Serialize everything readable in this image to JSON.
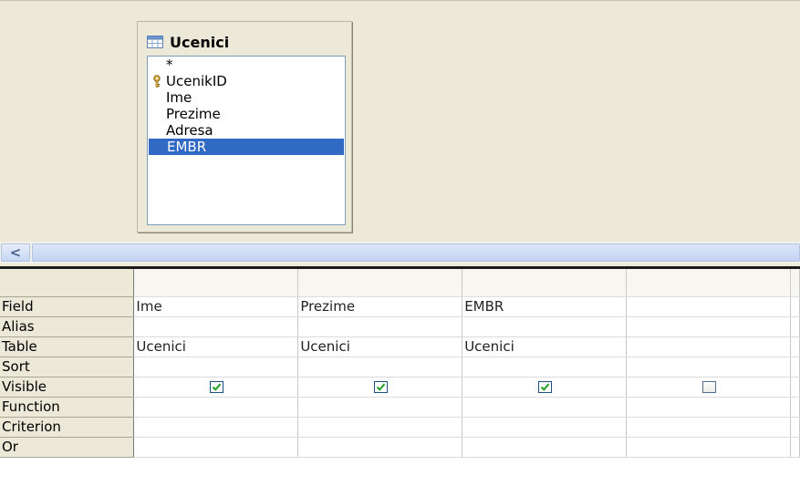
{
  "table_window": {
    "title": "Ucenici",
    "fields": [
      {
        "name": "*",
        "primary_key": false,
        "selected": false
      },
      {
        "name": "UcenikID",
        "primary_key": true,
        "selected": false
      },
      {
        "name": "Ime",
        "primary_key": false,
        "selected": false
      },
      {
        "name": "Prezime",
        "primary_key": false,
        "selected": false
      },
      {
        "name": "Adresa",
        "primary_key": false,
        "selected": false
      },
      {
        "name": "EMBR",
        "primary_key": false,
        "selected": true
      }
    ]
  },
  "scrollbar": {
    "left_arrow": "<"
  },
  "grid": {
    "row_labels": {
      "field": "Field",
      "alias": "Alias",
      "table": "Table",
      "sort": "Sort",
      "visible": "Visible",
      "function": "Function",
      "criterion": "Criterion",
      "or": "Or"
    },
    "columns": [
      {
        "field": "Ime",
        "alias": "",
        "table": "Ucenici",
        "sort": "",
        "visible": true,
        "function": "",
        "criterion": "",
        "or": ""
      },
      {
        "field": "Prezime",
        "alias": "",
        "table": "Ucenici",
        "sort": "",
        "visible": true,
        "function": "",
        "criterion": "",
        "or": ""
      },
      {
        "field": "EMBR",
        "alias": "",
        "table": "Ucenici",
        "sort": "",
        "visible": true,
        "function": "",
        "criterion": "",
        "or": ""
      },
      {
        "field": "",
        "alias": "",
        "table": "",
        "sort": "",
        "visible": false,
        "function": "",
        "criterion": "",
        "or": ""
      }
    ]
  },
  "colors": {
    "selection": "#316ac5",
    "panel_background": "#ece9d8",
    "checkbox_check": "#21a121"
  },
  "icons": {
    "table": "table-icon",
    "primary_key": "key-icon",
    "scroll_left": "chevron-left-icon"
  }
}
